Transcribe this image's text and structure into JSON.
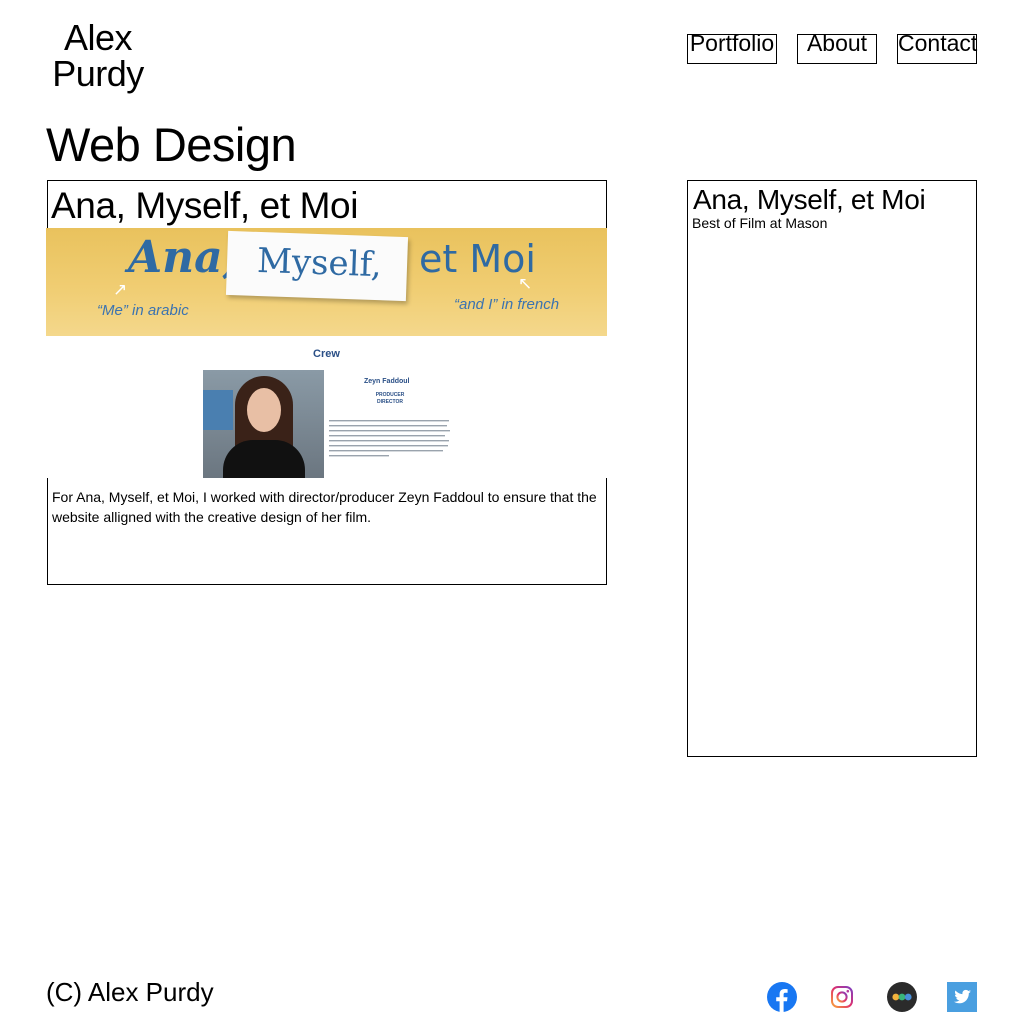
{
  "logo": {
    "line1": "Alex",
    "line2": "Purdy"
  },
  "nav": {
    "portfolio": "Portfolio",
    "about": "About",
    "contact": "Contact"
  },
  "page": {
    "title": "Web Design"
  },
  "project": {
    "title": "Ana, Myself, et Moi",
    "image": {
      "banner_ana": "Ana,",
      "banner_myself": "Myself,",
      "banner_etmoi": "et Moi",
      "banner_note_left": "“Me” in arabic",
      "banner_note_right": "“and I” in french",
      "crew_label": "Crew",
      "crew_name": "Zeyn Faddoul",
      "crew_role": "PRODUCER DIRECTOR"
    },
    "description": "For Ana, Myself, et Moi, I worked with director/producer Zeyn Faddoul to ensure that the website alligned with the creative design of her film."
  },
  "side_panel": {
    "title": "Ana, Myself, et Moi",
    "subtitle": "Best of Film at Mason"
  },
  "footer": {
    "copyright": "(C) Alex Purdy",
    "social_icons": [
      "facebook-icon",
      "instagram-icon",
      "medium-icon",
      "twitter-icon"
    ]
  },
  "colors": {
    "facebook": "#1877f2",
    "twitter": "#4a9fe0",
    "medium_bg": "#2b2b2b",
    "banner_text": "#2f6aa3",
    "banner_bg": "#f0cd72"
  }
}
